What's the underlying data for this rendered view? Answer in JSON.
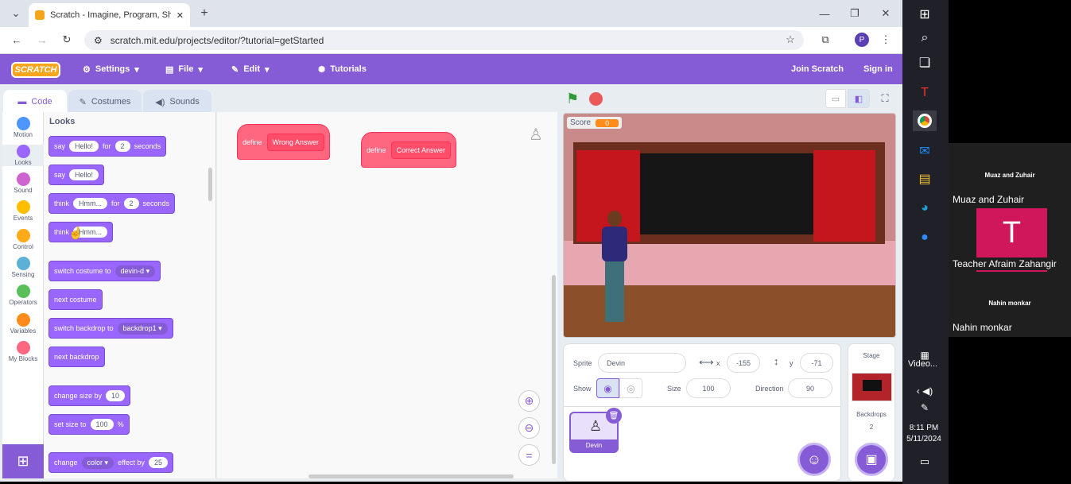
{
  "browser": {
    "tab_title": "Scratch - Imagine, Program, Sh",
    "url": "scratch.mit.edu/projects/editor/?tutorial=getStarted",
    "profile_initial": "P"
  },
  "menu": {
    "logo": "SCRATCH",
    "settings": "Settings",
    "file": "File",
    "edit": "Edit",
    "tutorials": "Tutorials",
    "join": "Join Scratch",
    "signin": "Sign in"
  },
  "tabs": {
    "code": "Code",
    "costumes": "Costumes",
    "sounds": "Sounds"
  },
  "categories": [
    {
      "label": "Motion",
      "color": "#4c97ff"
    },
    {
      "label": "Looks",
      "color": "#9966ff"
    },
    {
      "label": "Sound",
      "color": "#cf63cf"
    },
    {
      "label": "Events",
      "color": "#ffbf00"
    },
    {
      "label": "Control",
      "color": "#ffab19"
    },
    {
      "label": "Sensing",
      "color": "#5cb1d6"
    },
    {
      "label": "Operators",
      "color": "#59c059"
    },
    {
      "label": "Variables",
      "color": "#ff8c1a"
    },
    {
      "label": "My Blocks",
      "color": "#ff6680"
    }
  ],
  "palette": {
    "heading": "Looks",
    "b1": {
      "w1": "say",
      "v1": "Hello!",
      "w2": "for",
      "v2": "2",
      "w3": "seconds"
    },
    "b2": {
      "w1": "say",
      "v1": "Hello!"
    },
    "b3": {
      "w1": "think",
      "v1": "Hmm...",
      "w2": "for",
      "v2": "2",
      "w3": "seconds"
    },
    "b4": {
      "w1": "think",
      "v1": "Hmm..."
    },
    "b5": {
      "w1": "switch costume to",
      "v1": "devin-d"
    },
    "b6": {
      "w1": "next costume"
    },
    "b7": {
      "w1": "switch backdrop to",
      "v1": "backdrop1"
    },
    "b8": {
      "w1": "next backdrop"
    },
    "b9": {
      "w1": "change size by",
      "v1": "10"
    },
    "b10": {
      "w1": "set size to",
      "v1": "100",
      "w2": "%"
    },
    "b11": {
      "w1": "change",
      "v1": "color",
      "w2": "effect by",
      "v2": "25"
    }
  },
  "workspace": {
    "def1": {
      "kw": "define",
      "name": "Wrong Answer"
    },
    "def2": {
      "kw": "define",
      "name": "Correct Answer"
    }
  },
  "stage": {
    "score_label": "Score",
    "score_value": "0"
  },
  "sprite": {
    "label": "Sprite",
    "name": "Devin",
    "x_label": "x",
    "x": "-155",
    "y_label": "y",
    "y": "-71",
    "show_label": "Show",
    "size_label": "Size",
    "size": "100",
    "direction_label": "Direction",
    "direction": "90",
    "thumb_name": "Devin"
  },
  "stage_panel": {
    "title": "Stage",
    "backdrops_label": "Backdrops",
    "backdrops_count": "2"
  },
  "meeting": {
    "top_name": "Muaz and Zuhair",
    "top_name2": "Muaz and Zuhair",
    "avatar": "T",
    "teacher": "Teacher Afraim Zahangir",
    "bottom_small": "Nahin monkar",
    "bottom": "Nahin monkar"
  },
  "taskbar": {
    "video_label": "Video...",
    "time": "8:11 PM",
    "date": "5/11/2024"
  }
}
